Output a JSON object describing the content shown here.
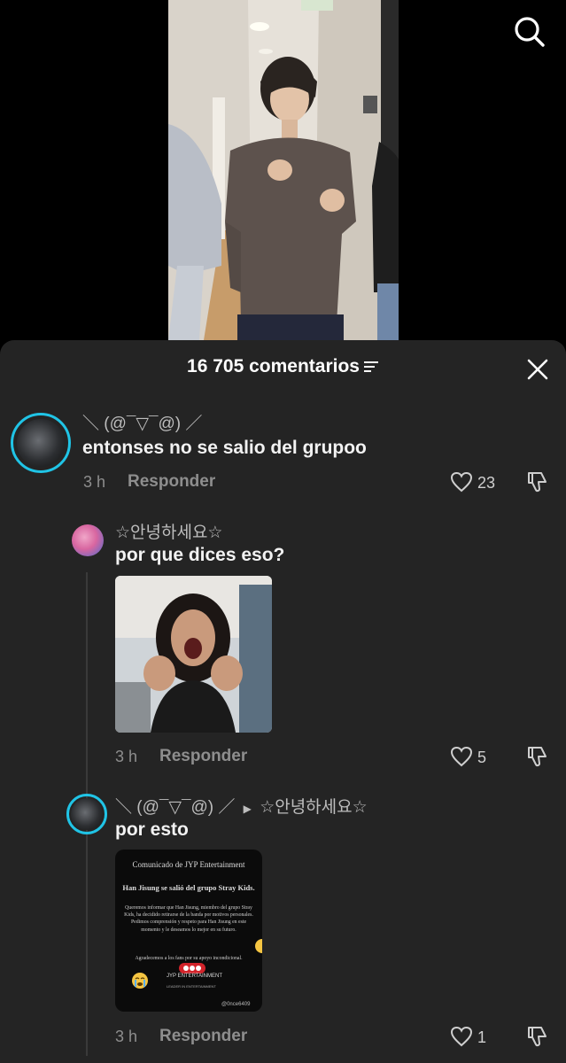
{
  "sheet": {
    "comment_count": "16 705 comentarios"
  },
  "comments": [
    {
      "username": "＼ (@¯▽¯@) ／",
      "text": "entonses no se salio del grupoo",
      "time": "3 h",
      "reply_label": "Responder",
      "likes": "23"
    },
    {
      "username": "☆안녕하세요☆",
      "text": "por que dices eso?",
      "time": "3 h",
      "reply_label": "Responder",
      "likes": "5"
    },
    {
      "username": "＼ (@¯▽¯@) ／",
      "reply_to": "☆안녕하세요☆",
      "text": "por esto",
      "time": "3 h",
      "reply_label": "Responder",
      "likes": "1"
    }
  ],
  "document_image": {
    "title": "Comunicado de JYP Entertainment",
    "headline": "Han Jisung se salió del grupo Stray Kids.",
    "body": "Queremos informar que Han Jisung, miembro del grupo Stray Kids, ha decidido retirarse de la banda por motivos personales. Pedimos comprensión y respeto para Han Jisung en este momento y le deseamos lo mejor en su futuro.",
    "thanks": "Agradecemos a los fans por su apoyo incondicional.",
    "brand": "JYP ENTERTAINMENT",
    "brand_sub": "LEADER IN ENTERTAINMENT",
    "handle": "@0nce6409"
  },
  "icons": {
    "search": "search-icon",
    "close": "close-icon",
    "filter": "filter-icon",
    "like": "heart-icon",
    "dislike": "thumbs-down-icon"
  },
  "colors": {
    "sheet_bg": "#242424",
    "avatar_ring": "#20c4e6",
    "muted_text": "#8e8e8e"
  }
}
